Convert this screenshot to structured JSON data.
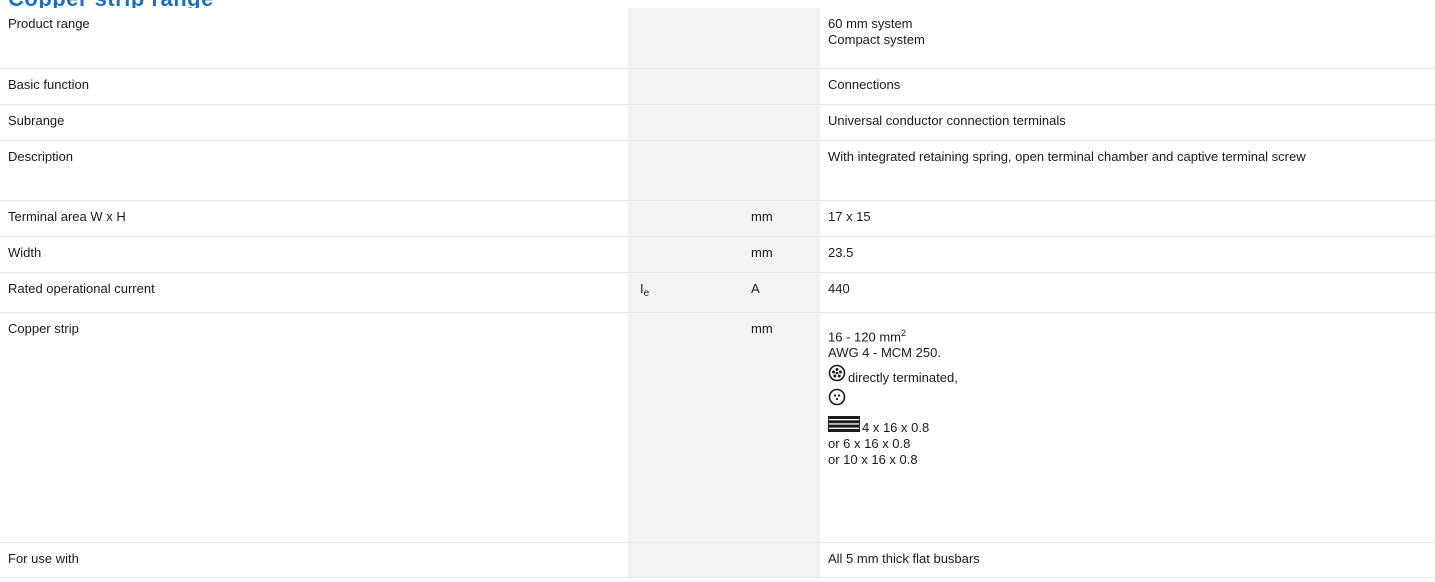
{
  "header": {
    "title": "Copper strip range"
  },
  "rows": [
    {
      "label": "Product range",
      "symbol": "",
      "unit": "",
      "value": [
        "60 mm system",
        "Compact system"
      ]
    },
    {
      "label": "Basic function",
      "symbol": "",
      "unit": "",
      "value": [
        "Connections"
      ]
    },
    {
      "label": "Subrange",
      "symbol": "",
      "unit": "",
      "value": [
        "Universal conductor connection terminals"
      ]
    },
    {
      "label": "Description",
      "symbol": "",
      "unit": "",
      "value": [
        "With integrated retaining spring, open terminal chamber and captive terminal screw"
      ]
    },
    {
      "label": "Terminal area W x H",
      "symbol": "",
      "unit": "mm",
      "value": [
        "17 x 15"
      ]
    },
    {
      "label": "Width",
      "symbol": "",
      "unit": "mm",
      "value": [
        "23.5"
      ]
    },
    {
      "label": "Rated operational current",
      "symbol": "I",
      "symbol_sub": "e",
      "unit": "A",
      "value": [
        "440"
      ]
    },
    {
      "label": "Copper strip",
      "symbol": "",
      "unit": "mm",
      "cross_section": "16 - 120 mm",
      "cross_section_sup": "2",
      "awg": "AWG 4 - MCM 250.",
      "directly_terminated": "directly terminated,",
      "strip_first": "4 x 16 x 0.8",
      "strip_more": [
        "or 6 x 16 x 0.8",
        "or 10 x 16 x 0.8"
      ],
      "icons": [
        "stranded-conductor-icon",
        "solid-conductor-icon",
        "lamellar-strip-icon"
      ]
    },
    {
      "label": "For use with",
      "symbol": "",
      "unit": "",
      "value": [
        "All 5 mm thick flat busbars"
      ]
    }
  ],
  "colors": {
    "title": "#1f6fb6",
    "shade": "#f3f3f3",
    "rule": "#e8e8e8",
    "text": "#1a1a1a"
  }
}
